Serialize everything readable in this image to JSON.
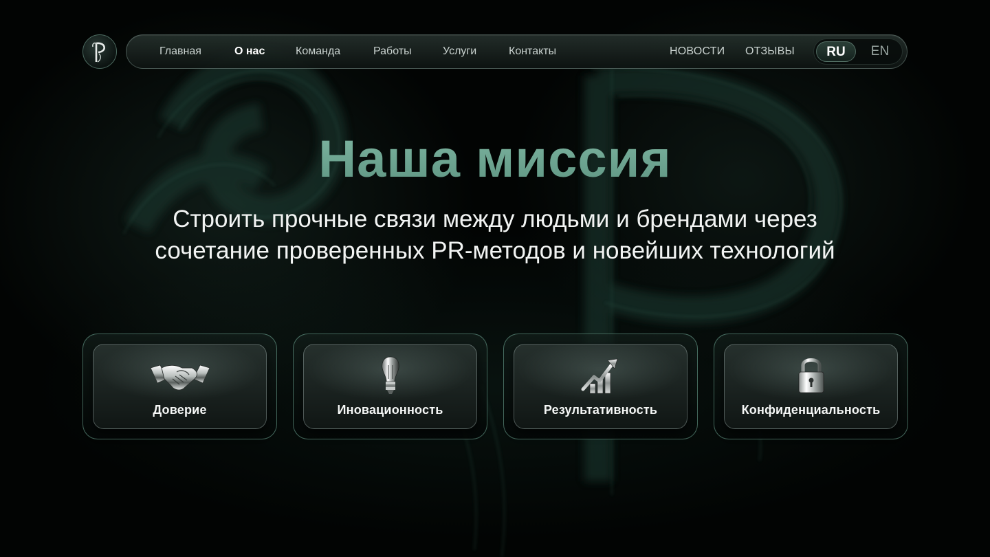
{
  "brand": {
    "logo_icon": "monogram-logo-icon"
  },
  "nav": {
    "items": [
      {
        "label": "Главная",
        "active": false
      },
      {
        "label": "О нас",
        "active": true
      },
      {
        "label": "Команда",
        "active": false
      },
      {
        "label": "Работы",
        "active": false
      },
      {
        "label": "Услуги",
        "active": false
      },
      {
        "label": "Контакты",
        "active": false
      }
    ],
    "secondary": [
      {
        "label": "НОВОСТИ"
      },
      {
        "label": "ОТЗЫВЫ"
      }
    ],
    "languages": [
      {
        "label": "RU",
        "selected": true
      },
      {
        "label": "EN",
        "selected": false
      }
    ]
  },
  "hero": {
    "title": "Наша миссия",
    "subtitle_line1": "Строить прочные связи между людьми и брендами через",
    "subtitle_line2": "сочетание проверенных PR-методов и новейших технологий"
  },
  "values": [
    {
      "label": "Доверие",
      "icon": "handshake-icon"
    },
    {
      "label": "Иновационность",
      "icon": "light-bulb-icon"
    },
    {
      "label": "Результативность",
      "icon": "growth-chart-icon"
    },
    {
      "label": "Конфиденциальность",
      "icon": "padlock-icon"
    }
  ],
  "colors": {
    "accent": "#6fa692",
    "background": "#020403",
    "card_border": "#78b4a0"
  }
}
